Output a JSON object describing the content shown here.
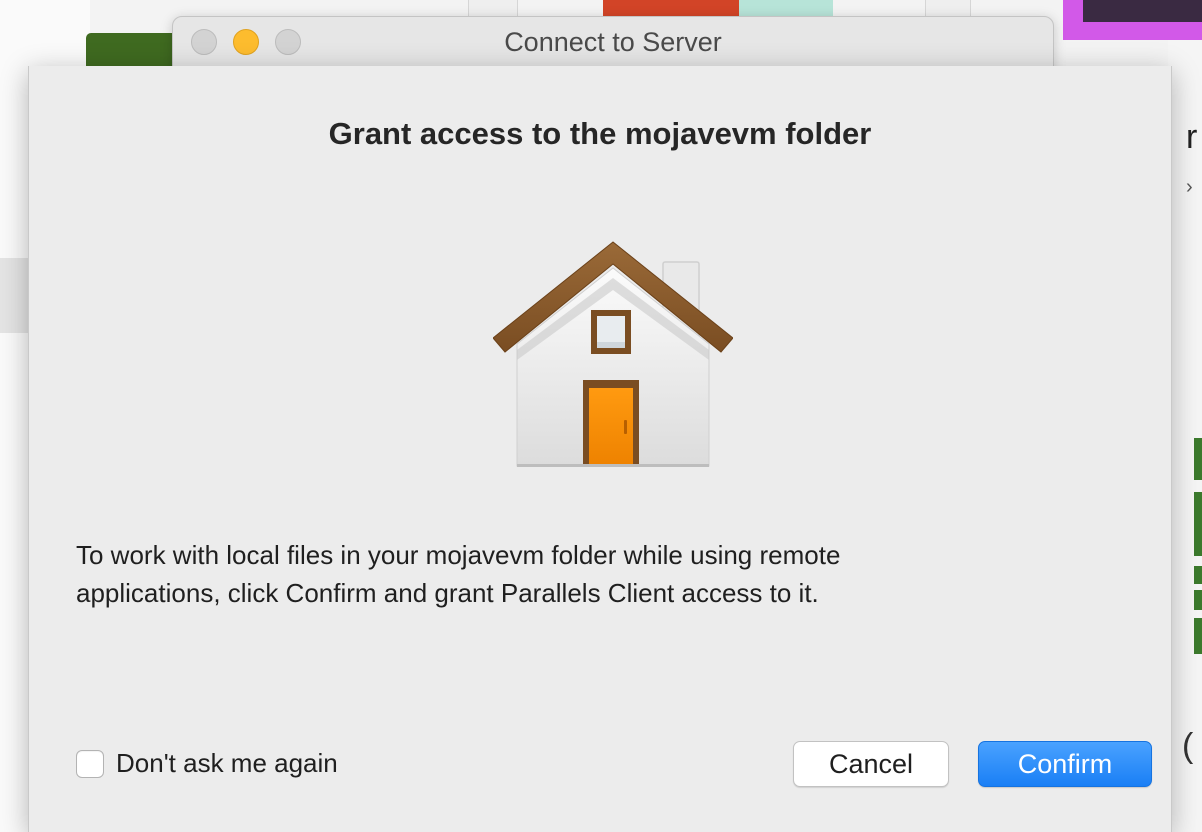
{
  "parent_window": {
    "title": "Connect to Server"
  },
  "dialog": {
    "title": "Grant access to the mojavevm folder",
    "icon": "home-folder-icon",
    "message_lines": [
      "To work with local files in your mojavevm folder while using remote",
      "applications, click Confirm and grant Parallels Client access to it."
    ],
    "checkbox": {
      "label": "Don't ask me again",
      "checked": false
    },
    "buttons": {
      "cancel_label": "Cancel",
      "confirm_label": "Confirm"
    }
  },
  "colors": {
    "accent": "#1a7ff5",
    "house_door": "#f08a00",
    "house_roof": "#8a5a2b",
    "window_yellow": "#fdbc2e"
  }
}
